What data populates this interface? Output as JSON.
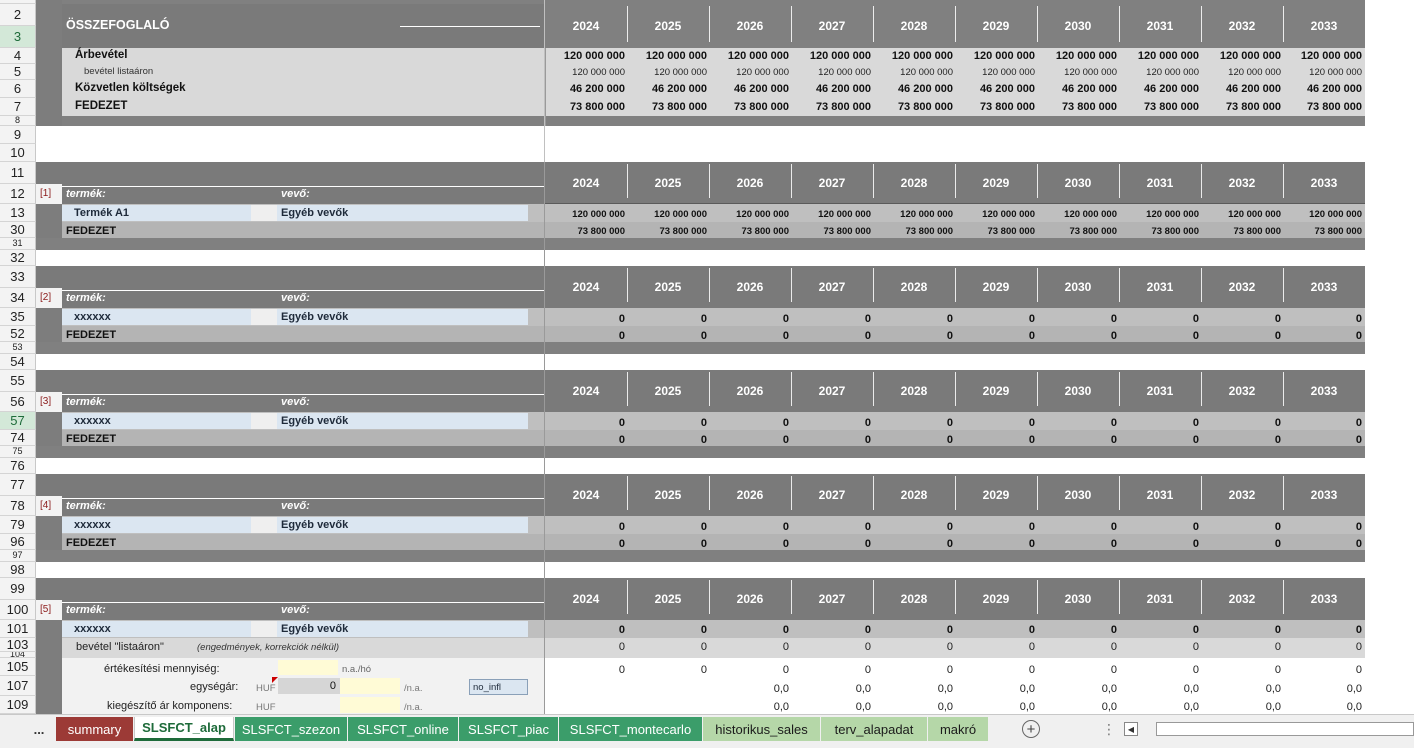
{
  "years": [
    "2024",
    "2025",
    "2026",
    "2027",
    "2028",
    "2029",
    "2030",
    "2031",
    "2032",
    "2033"
  ],
  "summary": {
    "title": "ÖSSZEFOGLALÓ",
    "rows": [
      {
        "label": "Árbevétel",
        "values": [
          "120 000 000",
          "120 000 000",
          "120 000 000",
          "120 000 000",
          "120 000 000",
          "120 000 000",
          "120 000 000",
          "120 000 000",
          "120 000 000",
          "120 000 000"
        ]
      },
      {
        "label": "bevétel listaáron",
        "values": [
          "120 000 000",
          "120 000 000",
          "120 000 000",
          "120 000 000",
          "120 000 000",
          "120 000 000",
          "120 000 000",
          "120 000 000",
          "120 000 000",
          "120 000 000"
        ]
      },
      {
        "label": "Közvetlen költségek",
        "values": [
          "46 200 000",
          "46 200 000",
          "46 200 000",
          "46 200 000",
          "46 200 000",
          "46 200 000",
          "46 200 000",
          "46 200 000",
          "46 200 000",
          "46 200 000"
        ]
      },
      {
        "label": "FEDEZET",
        "values": [
          "73 800 000",
          "73 800 000",
          "73 800 000",
          "73 800 000",
          "73 800 000",
          "73 800 000",
          "73 800 000",
          "73 800 000",
          "73 800 000",
          "73 800 000"
        ]
      }
    ]
  },
  "labels": {
    "termek": "termék:",
    "vevo": "vevő:",
    "fedezet": "FEDEZET"
  },
  "blocks": [
    {
      "index": "[1]",
      "product": "Termék A1",
      "customer": "Egyéb vevők",
      "rows": [
        "11",
        "12",
        "13",
        "30",
        "31"
      ],
      "revenue": [
        "120 000 000",
        "120 000 000",
        "120 000 000",
        "120 000 000",
        "120 000 000",
        "120 000 000",
        "120 000 000",
        "120 000 000",
        "120 000 000",
        "120 000 000"
      ],
      "margin": [
        "73 800 000",
        "73 800 000",
        "73 800 000",
        "73 800 000",
        "73 800 000",
        "73 800 000",
        "73 800 000",
        "73 800 000",
        "73 800 000",
        "73 800 000"
      ]
    },
    {
      "index": "[2]",
      "product": "xxxxxx",
      "customer": "Egyéb vevők",
      "rows": [
        "33",
        "34",
        "35",
        "52",
        "53"
      ],
      "revenue": [
        "0",
        "0",
        "0",
        "0",
        "0",
        "0",
        "0",
        "0",
        "0",
        "0"
      ],
      "margin": [
        "0",
        "0",
        "0",
        "0",
        "0",
        "0",
        "0",
        "0",
        "0",
        "0"
      ]
    },
    {
      "index": "[3]",
      "product": "xxxxxx",
      "customer": "Egyéb vevők",
      "rows": [
        "55",
        "56",
        "57",
        "74",
        "75"
      ],
      "revenue": [
        "0",
        "0",
        "0",
        "0",
        "0",
        "0",
        "0",
        "0",
        "0",
        "0"
      ],
      "margin": [
        "0",
        "0",
        "0",
        "0",
        "0",
        "0",
        "0",
        "0",
        "0",
        "0"
      ]
    },
    {
      "index": "[4]",
      "product": "xxxxxx",
      "customer": "Egyéb vevők",
      "rows": [
        "77",
        "78",
        "79",
        "96",
        "97"
      ],
      "revenue": [
        "0",
        "0",
        "0",
        "0",
        "0",
        "0",
        "0",
        "0",
        "0",
        "0"
      ],
      "margin": [
        "0",
        "0",
        "0",
        "0",
        "0",
        "0",
        "0",
        "0",
        "0",
        "0"
      ]
    }
  ],
  "block5": {
    "index": "[5]",
    "product": "xxxxxx",
    "customer": "Egyéb vevők",
    "rows": [
      "99",
      "100",
      "101",
      "103",
      "104",
      "105",
      "107",
      "109"
    ],
    "revenue": [
      "0",
      "0",
      "0",
      "0",
      "0",
      "0",
      "0",
      "0",
      "0",
      "0"
    ],
    "list_price_label": "bevétel \"listaáron\"",
    "list_price_note": "(engedmények, korrekciók nélkül)",
    "list_price_values": [
      "0",
      "0",
      "0",
      "0",
      "0",
      "0",
      "0",
      "0",
      "0",
      "0"
    ],
    "quantity": {
      "label": "értékesítési mennyiség:",
      "unit": "n.a./hó",
      "values": [
        "0",
        "0",
        "0",
        "0",
        "0",
        "0",
        "0",
        "0",
        "0",
        "0"
      ]
    },
    "unit_price": {
      "label": "egységár:",
      "currency": "HUF",
      "input": "0",
      "unit": "/n.a.",
      "option": "no_infl",
      "values": [
        "",
        "",
        "0,0",
        "0,0",
        "0,0",
        "0,0",
        "0,0",
        "0,0",
        "0,0",
        "0,0"
      ]
    },
    "supplement": {
      "label": "kiegészítő ár komponens:",
      "currency": "HUF",
      "unit": "/n.a.",
      "values": [
        "",
        "",
        "0,0",
        "0,0",
        "0,0",
        "0,0",
        "0,0",
        "0,0",
        "0,0",
        "0,0"
      ]
    }
  },
  "row_numbers_top": [
    "2",
    "3",
    "4",
    "5",
    "6",
    "7",
    "8",
    "9",
    "10"
  ],
  "row_numbers_gap": [
    "32",
    "54",
    "76",
    "98"
  ],
  "tabs": {
    "more": "...",
    "items": [
      "summary",
      "SLSFCT_alap",
      "SLSFCT_szezon",
      "SLSFCT_online",
      "SLSFCT_piac",
      "SLSFCT_montecarlo",
      "historikus_sales",
      "terv_alapadat",
      "makró"
    ],
    "active": "SLSFCT_alap"
  },
  "colors": {
    "header": "#7a7a7a",
    "dark": "#808080",
    "light": "#d9d9d9",
    "mid": "#bfbfbf",
    "input": "#dbe6f1"
  }
}
